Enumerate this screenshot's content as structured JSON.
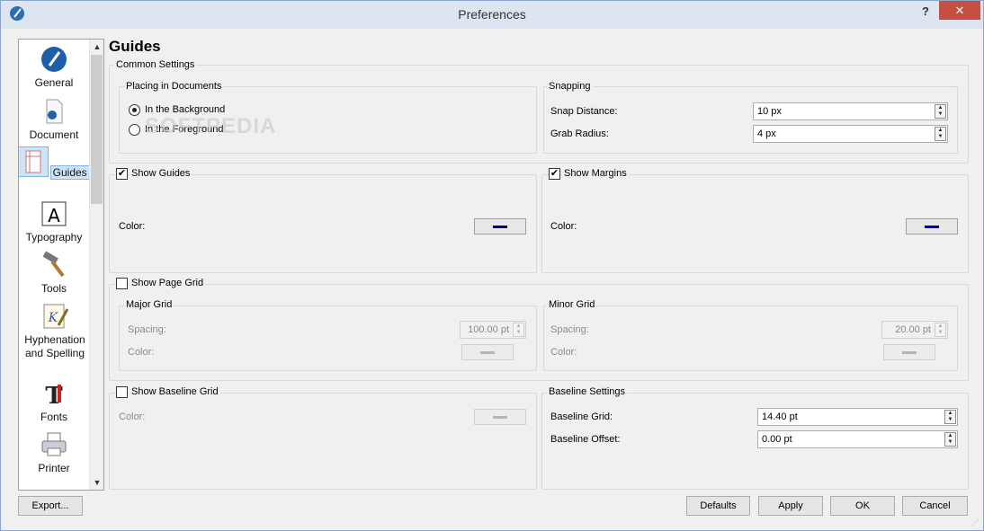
{
  "window": {
    "title": "Preferences",
    "help": "?",
    "close": "✕"
  },
  "sidebar": {
    "items": [
      {
        "label": "General",
        "icon": "general-pen-icon"
      },
      {
        "label": "Document",
        "icon": "document-icon"
      },
      {
        "label": "Guides",
        "icon": "guides-icon",
        "selected": true
      },
      {
        "label": "Typography",
        "icon": "typography-A-icon"
      },
      {
        "label": "Tools",
        "icon": "hammer-icon"
      },
      {
        "label": "Hyphenation and Spelling",
        "icon": "hyphenation-icon"
      },
      {
        "label": "Fonts",
        "icon": "fonts-icon"
      },
      {
        "label": "Printer",
        "icon": "printer-icon"
      }
    ]
  },
  "page_title": "Guides",
  "common": {
    "label": "Common Settings",
    "placing": {
      "label": "Placing in Documents",
      "options": [
        "In the Background",
        "In the Foreground"
      ],
      "selected": "In the Background"
    },
    "snapping": {
      "label": "Snapping",
      "snap_distance_label": "Snap Distance:",
      "snap_distance": "10 px",
      "grab_radius_label": "Grab Radius:",
      "grab_radius": "4 px"
    }
  },
  "show_guides": {
    "label": "Show Guides",
    "checked": true,
    "color_label": "Color:",
    "color": "#00008b"
  },
  "show_margins": {
    "label": "Show Margins",
    "checked": true,
    "color_label": "Color:",
    "color": "#0000cd"
  },
  "page_grid": {
    "label": "Show Page Grid",
    "checked": false,
    "major": {
      "label": "Major Grid",
      "spacing_label": "Spacing:",
      "spacing": "100.00 pt",
      "color_label": "Color:"
    },
    "minor": {
      "label": "Minor Grid",
      "spacing_label": "Spacing:",
      "spacing": "20.00 pt",
      "color_label": "Color:"
    }
  },
  "baseline_grid": {
    "label": "Show Baseline Grid",
    "checked": false,
    "color_label": "Color:"
  },
  "baseline_settings": {
    "label": "Baseline Settings",
    "grid_label": "Baseline Grid:",
    "grid": "14.40 pt",
    "offset_label": "Baseline Offset:",
    "offset": "0.00 pt"
  },
  "buttons": {
    "export": "Export...",
    "defaults": "Defaults",
    "apply": "Apply",
    "ok": "OK",
    "cancel": "Cancel"
  },
  "watermark": "SOFTPEDIA"
}
